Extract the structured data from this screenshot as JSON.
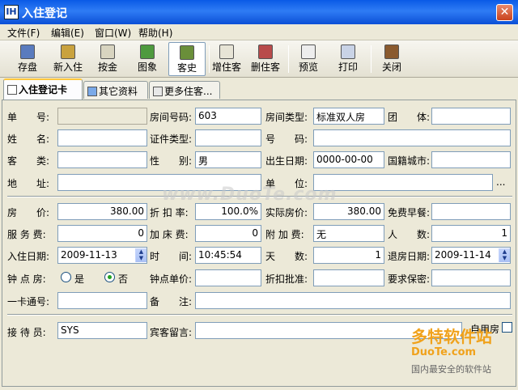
{
  "window": {
    "title": "入住登记",
    "app_icon": "IH",
    "close_glyph": "✕"
  },
  "menu": [
    "文件(F)",
    "编辑(E)",
    "窗口(W)",
    "帮助(H)"
  ],
  "toolbar": [
    "存盘",
    "新入住",
    "按金",
    "图象",
    "客史",
    "增住客",
    "删住客",
    "预览",
    "打印",
    "关闭"
  ],
  "toolbar_icons": [
    "save-icon",
    "new-checkin-icon",
    "deposit-icon",
    "image-icon",
    "guest-history-icon",
    "add-guest-icon",
    "delete-guest-icon",
    "preview-icon",
    "print-icon",
    "close-door-icon"
  ],
  "tabs": [
    "入住登记卡",
    "其它资料",
    "更多住客..."
  ],
  "form": {
    "dan_hao": "单　　号:",
    "room_no_label": "房间号码:",
    "room_no": "603",
    "room_type_label": "房间类型:",
    "room_type": "标准双人房",
    "group_label": "团　　体:",
    "name_label": "姓　　名:",
    "id_type_label": "证件类型:",
    "id_no_label": "号　　码:",
    "guest_type_label": "客　　类:",
    "gender_label": "性　　别:",
    "gender": "男",
    "birth_label": "出生日期:",
    "birth": "0000-00-00",
    "nationality_label": "国籍城市:",
    "address_label": "地　　址:",
    "company_label": "单　　位:",
    "company_more": "...",
    "price_label": "房　　价:",
    "price": "380.00",
    "discount_label": "折 扣 率:",
    "discount": "100.0%",
    "actual_price_label": "实际房价:",
    "actual_price": "380.00",
    "breakfast_label": "免费早餐:",
    "service_label": "服 务 费:",
    "service": "0",
    "extra_bed_label": "加 床 费:",
    "extra_bed": "0",
    "surcharge_label": "附 加 费:",
    "surcharge": "无",
    "persons_label": "人　　数:",
    "persons": "1",
    "checkin_date_label": "入住日期:",
    "checkin_date": "2009-11-13",
    "time_label": "时　　间:",
    "time": "10:45:54",
    "days_label": "天　　数:",
    "days": "1",
    "checkout_label": "退房日期:",
    "checkout_date": "2009-11-14",
    "hourly_label": "钟 点 房:",
    "radio_yes": "是",
    "radio_no": "否",
    "hourly_price_label": "钟点单价:",
    "discount_approve_label": "折扣批准:",
    "secrecy_label": "要求保密:",
    "card_label": "一卡通号:",
    "remark_label": "备　　注:",
    "receptionist_label": "接 待 员:",
    "receptionist": "SYS",
    "message_label": "宾客留言:",
    "self_room_label": "自用房"
  },
  "watermark": {
    "site": "www.DuoTe.com",
    "brand": "多特软件站",
    "brand_en": "DuoTe.com",
    "slogan": "国内最安全的软件站"
  },
  "colors": {
    "title_blue": "#0A5AE6",
    "tab_highlight": "#FFC83C",
    "field_border": "#7F9DB9"
  }
}
